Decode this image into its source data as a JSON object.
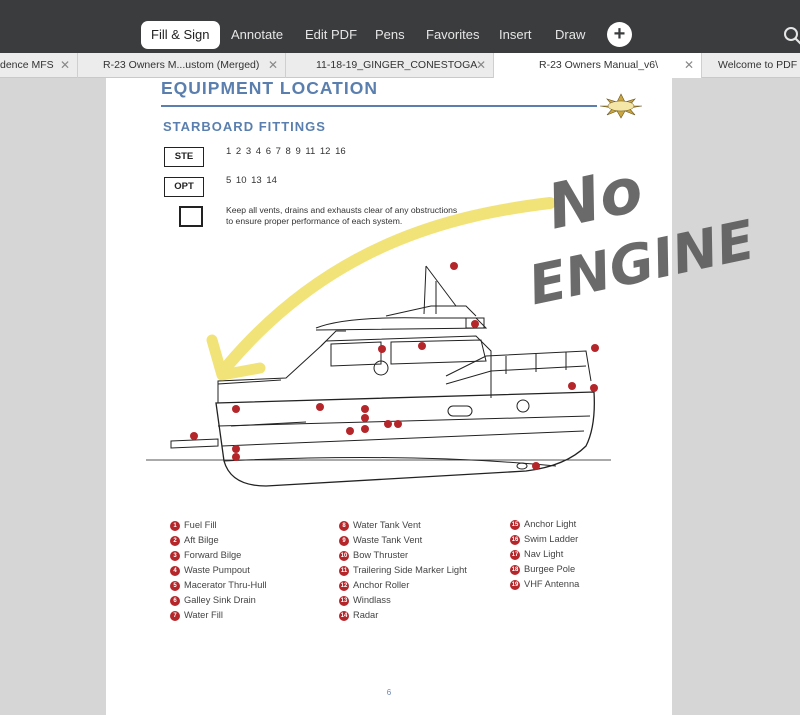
{
  "toolbar": {
    "tabs": [
      {
        "label": "Fill & Sign",
        "active": true
      },
      {
        "label": "Annotate",
        "active": false
      },
      {
        "label": "Edit PDF",
        "active": false
      },
      {
        "label": "Pens",
        "active": false
      },
      {
        "label": "Favorites",
        "active": false
      },
      {
        "label": "Insert",
        "active": false
      },
      {
        "label": "Draw",
        "active": false
      }
    ],
    "add_icon": "plus-icon",
    "search_icon": "search-icon"
  },
  "doc_tabs": [
    {
      "title": "dence MFS",
      "active": false
    },
    {
      "title": "R-23 Owners M...ustom (Merged)",
      "active": false
    },
    {
      "title": "11-18-19_GINGER_CONESTOGA",
      "active": false
    },
    {
      "title": "R-23 Owners Manual_v6\\",
      "active": true
    },
    {
      "title": "Welcome to PDF E",
      "active": false
    }
  ],
  "page": {
    "heading": "EQUIPMENT LOCATION",
    "subheading": "STARBOARD FITTINGS",
    "ste_label": "STE",
    "ste_numbers": "1 2 3 4 6 7 8 9 11 12 16",
    "opt_label": "OPT",
    "opt_numbers": "5 10 13 14",
    "note_line1": "Keep all vents, drains and exhausts clear of any obstructions",
    "note_line2": "to ensure proper performance of each system.",
    "page_number": "6",
    "legend_col1": [
      {
        "n": "1",
        "label": "Fuel Fill"
      },
      {
        "n": "2",
        "label": "Aft Bilge"
      },
      {
        "n": "3",
        "label": "Forward Bilge"
      },
      {
        "n": "4",
        "label": "Waste Pumpout"
      },
      {
        "n": "5",
        "label": "Macerator Thru-Hull"
      },
      {
        "n": "6",
        "label": "Galley Sink Drain"
      },
      {
        "n": "7",
        "label": "Water Fill"
      }
    ],
    "legend_col2": [
      {
        "n": "8",
        "label": "Water Tank Vent"
      },
      {
        "n": "9",
        "label": "Waste Tank Vent"
      },
      {
        "n": "10",
        "label": "Bow Thruster"
      },
      {
        "n": "11",
        "label": "Trailering Side Marker Light"
      },
      {
        "n": "12",
        "label": "Anchor Roller"
      },
      {
        "n": "13",
        "label": "Windlass"
      },
      {
        "n": "14",
        "label": "Radar"
      }
    ],
    "legend_col3": [
      {
        "n": "15",
        "label": "Anchor Light"
      },
      {
        "n": "16",
        "label": "Swim Ladder"
      },
      {
        "n": "17",
        "label": "Nav Light"
      },
      {
        "n": "18",
        "label": "Burgee Pole"
      },
      {
        "n": "19",
        "label": "VHF Antenna"
      }
    ],
    "boat_markers": [
      "1",
      "2",
      "3",
      "4",
      "5",
      "6",
      "7",
      "8",
      "9",
      "10",
      "11",
      "12",
      "13",
      "14",
      "15",
      "16",
      "17",
      "18",
      "19"
    ]
  },
  "handwriting": {
    "line1": "No",
    "line2": "ENGINE",
    "ink_color": "#555555",
    "arrow_color": "#f1e06a"
  }
}
